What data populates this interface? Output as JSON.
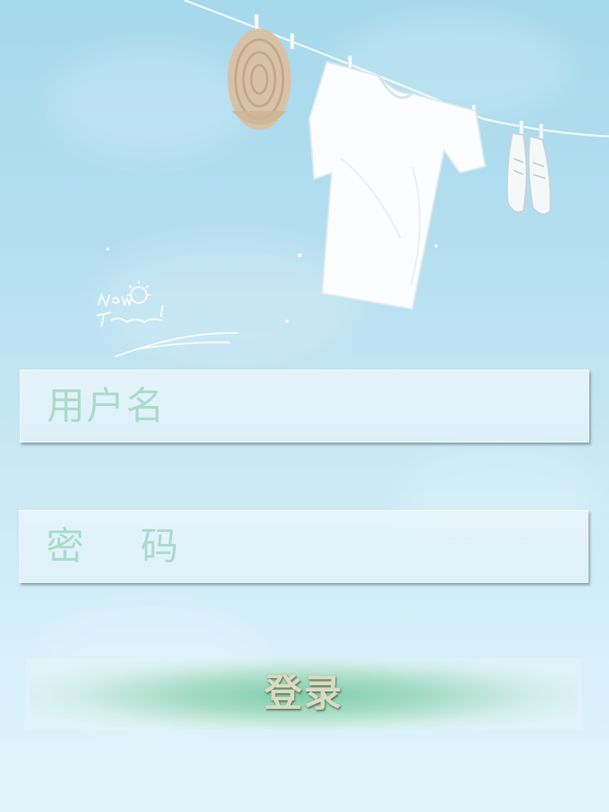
{
  "login_form": {
    "username_placeholder": "用户名",
    "password_placeholder": "密    码",
    "login_label": "登录"
  },
  "colors": {
    "sky": "#b4def0",
    "placeholder_text": "#a9dccb",
    "button_glow": "#7ccba8",
    "button_text": "#d9dcc0"
  }
}
